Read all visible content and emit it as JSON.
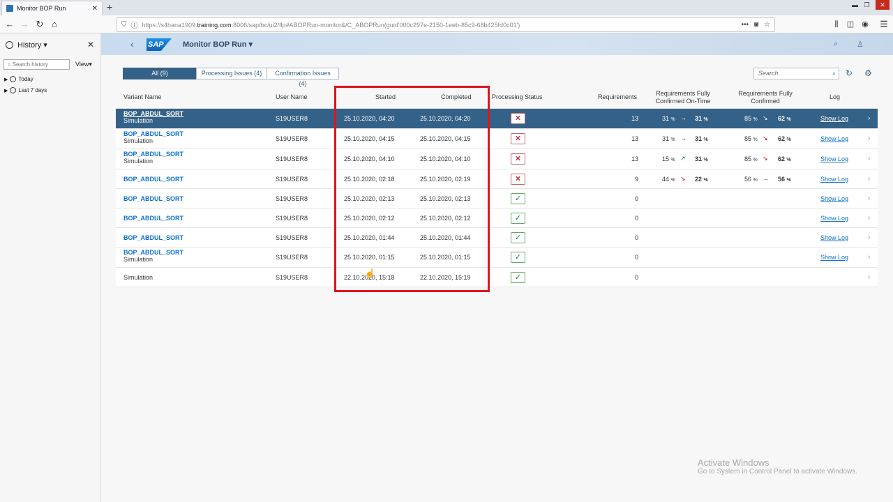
{
  "browser": {
    "tab_title": "Monitor BOP Run",
    "url_prefix": "https://s4hana1909.",
    "url_host": "training.com",
    "url_suffix": ":8006/sap/bc/ui2/flp#ABOPRun-monitor&/C_ABOPRun(guid'000c297e-2150-1eeb-85c9-68b425fd0c01')"
  },
  "sidebar": {
    "title": "History",
    "search_placeholder": "Search history",
    "view_label": "View",
    "items": [
      {
        "label": "Today"
      },
      {
        "label": "Last 7 days"
      }
    ]
  },
  "shell": {
    "logo": "SAP",
    "title": "Monitor BOP Run"
  },
  "filters": {
    "all": "All (9)",
    "processing": "Processing Issues (4)",
    "confirmation": "Confirmation Issues (4)"
  },
  "search": {
    "placeholder": "Search"
  },
  "columns": {
    "variant": "Variant Name",
    "user": "User Name",
    "started": "Started",
    "completed": "Completed",
    "status": "Processing Status",
    "requirements": "Requirements",
    "ontime_1": "Requirements Fully",
    "ontime_2": "Confirmed On-Time",
    "fully_1": "Requirements Fully",
    "fully_2": "Confirmed",
    "log": "Log"
  },
  "rows": [
    {
      "name": "BOP_ABDUL_SORT",
      "sub": "Simulation",
      "user": "S19USER8",
      "started": "25.10.2020, 04:20",
      "completed": "25.10.2020, 04:20",
      "status": "error",
      "req": "13",
      "ot_from": "31",
      "ot_arrow": "→",
      "ot_to": "31",
      "fc_from": "85",
      "fc_arrow": "↘",
      "fc_to": "62",
      "log": "Show Log"
    },
    {
      "name": "BOP_ABDUL_SORT",
      "sub": "Simulation",
      "user": "S19USER8",
      "started": "25.10.2020, 04:15",
      "completed": "25.10.2020, 04:15",
      "status": "error",
      "req": "13",
      "ot_from": "31",
      "ot_arrow": "→",
      "ot_to": "31",
      "fc_from": "85",
      "fc_arrow": "↘",
      "fc_to": "62",
      "log": "Show Log"
    },
    {
      "name": "BOP_ABDUL_SORT",
      "sub": "Simulation",
      "user": "S19USER8",
      "started": "25.10.2020, 04:10",
      "completed": "25.10.2020, 04:10",
      "status": "error",
      "req": "13",
      "ot_from": "15",
      "ot_arrow": "↗",
      "ot_to": "31",
      "fc_from": "85",
      "fc_arrow": "↘",
      "fc_to": "62",
      "log": "Show Log"
    },
    {
      "name": "BOP_ABDUL_SORT",
      "sub": "",
      "user": "S19USER8",
      "started": "25.10.2020, 02:18",
      "completed": "25.10.2020, 02:19",
      "status": "error",
      "req": "9",
      "ot_from": "44",
      "ot_arrow": "↘",
      "ot_to": "22",
      "fc_from": "56",
      "fc_arrow": "→",
      "fc_to": "56",
      "log": "Show Log"
    },
    {
      "name": "BOP_ABDUL_SORT",
      "sub": "",
      "user": "S19USER8",
      "started": "25.10.2020, 02:13",
      "completed": "25.10.2020, 02:13",
      "status": "ok",
      "req": "0",
      "log": "Show Log"
    },
    {
      "name": "BOP_ABDUL_SORT",
      "sub": "",
      "user": "S19USER8",
      "started": "25.10.2020, 02:12",
      "completed": "25.10.2020, 02:12",
      "status": "ok",
      "req": "0",
      "log": "Show Log"
    },
    {
      "name": "BOP_ABDUL_SORT",
      "sub": "",
      "user": "S19USER8",
      "started": "25.10.2020, 01:44",
      "completed": "25.10.2020, 01:44",
      "status": "ok",
      "req": "0",
      "log": "Show Log"
    },
    {
      "name": "BOP_ABDUL_SORT",
      "sub": "Simulation",
      "user": "S19USER8",
      "started": "25.10.2020, 01:15",
      "completed": "25.10.2020, 01:15",
      "status": "ok",
      "req": "0",
      "log": "Show Log"
    },
    {
      "name": "",
      "sub": "Simulation",
      "user": "S19USER8",
      "started": "22.10.2020, 15:18",
      "completed": "22.10.2020, 15:19",
      "status": "ok",
      "req": "0",
      "log": ""
    }
  ],
  "percent_sign": "%",
  "watermark": {
    "line1": "Activate Windows",
    "line2": "Go to System in Control Panel to activate Windows."
  },
  "colors": {
    "shell_blue": "#346187",
    "link_blue": "#0a6ed1",
    "error_red": "#bb0000",
    "success_green": "#107e3e",
    "highlight_red": "#e0141e"
  }
}
